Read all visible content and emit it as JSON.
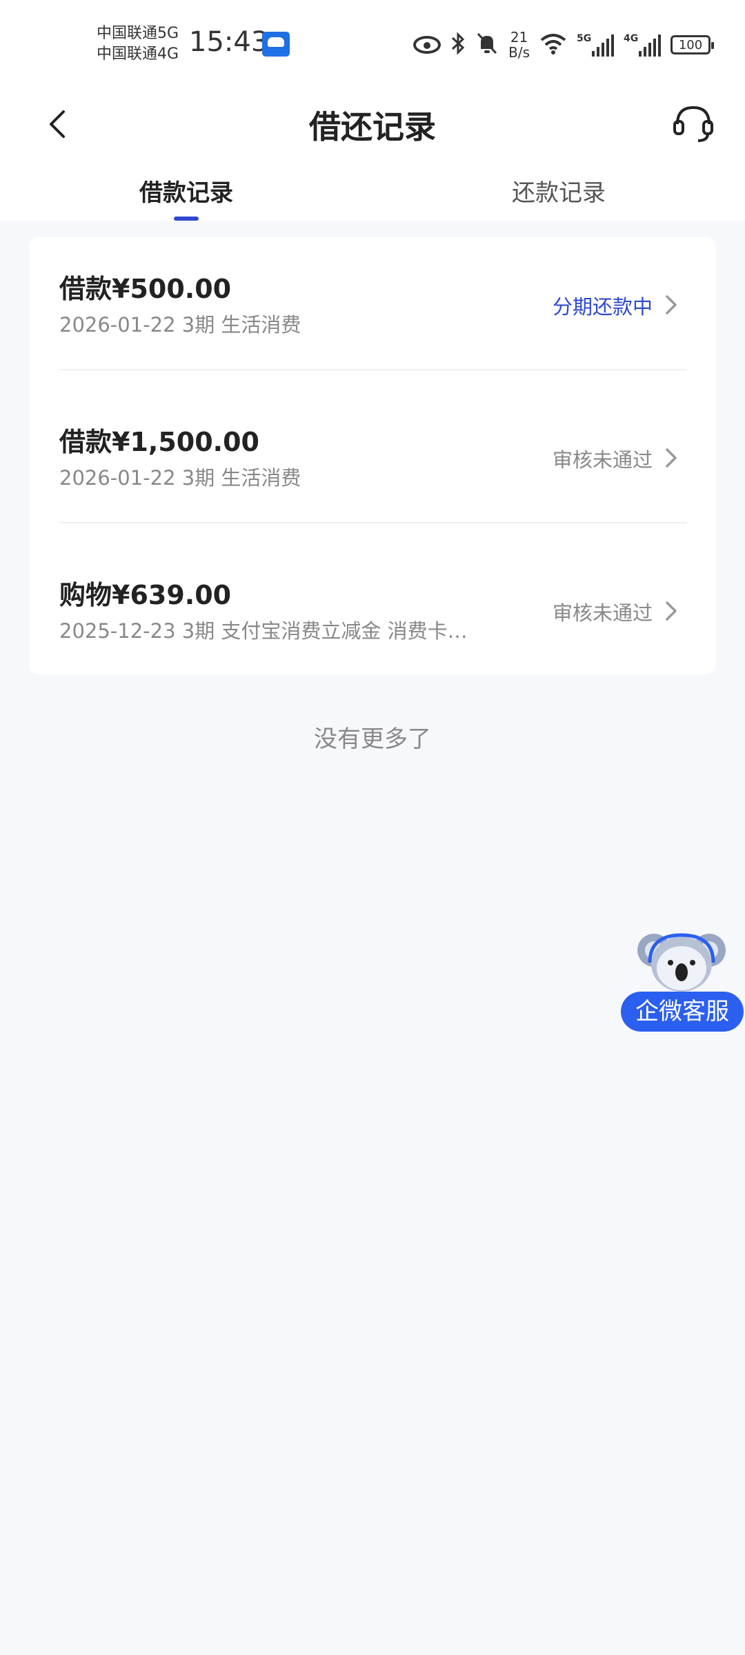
{
  "status_bar": {
    "carrier_1": "中国联通5G",
    "carrier_2": "中国联通4G",
    "time": "15:43",
    "net_speed_value": "21",
    "net_speed_unit": "B/s",
    "signal_1_tag": "5G",
    "signal_2_tag": "4G",
    "battery": "100"
  },
  "header": {
    "title": "借还记录"
  },
  "tabs": [
    {
      "label": "借款记录",
      "active": true
    },
    {
      "label": "还款记录",
      "active": false
    }
  ],
  "records": [
    {
      "type": "借款",
      "amount": "¥500.00",
      "meta": "2026-01-22 3期  生活消费",
      "status": "分期还款中"
    },
    {
      "type": "借款",
      "amount": "¥1,500.00",
      "meta": "2026-01-22 3期  生活消费",
      "status": "审核未通过"
    },
    {
      "type": "购物",
      "amount": "¥639.00",
      "meta": "2025-12-23 3期  支付宝消费立减金 消费卡…",
      "status": "审核未通过"
    }
  ],
  "footer": {
    "no_more": "没有更多了"
  },
  "float_service": {
    "label": "企微客服"
  },
  "colors": {
    "accent": "#2f49d1",
    "float_button": "#2a5ff0",
    "background": "#f7f8fc"
  }
}
